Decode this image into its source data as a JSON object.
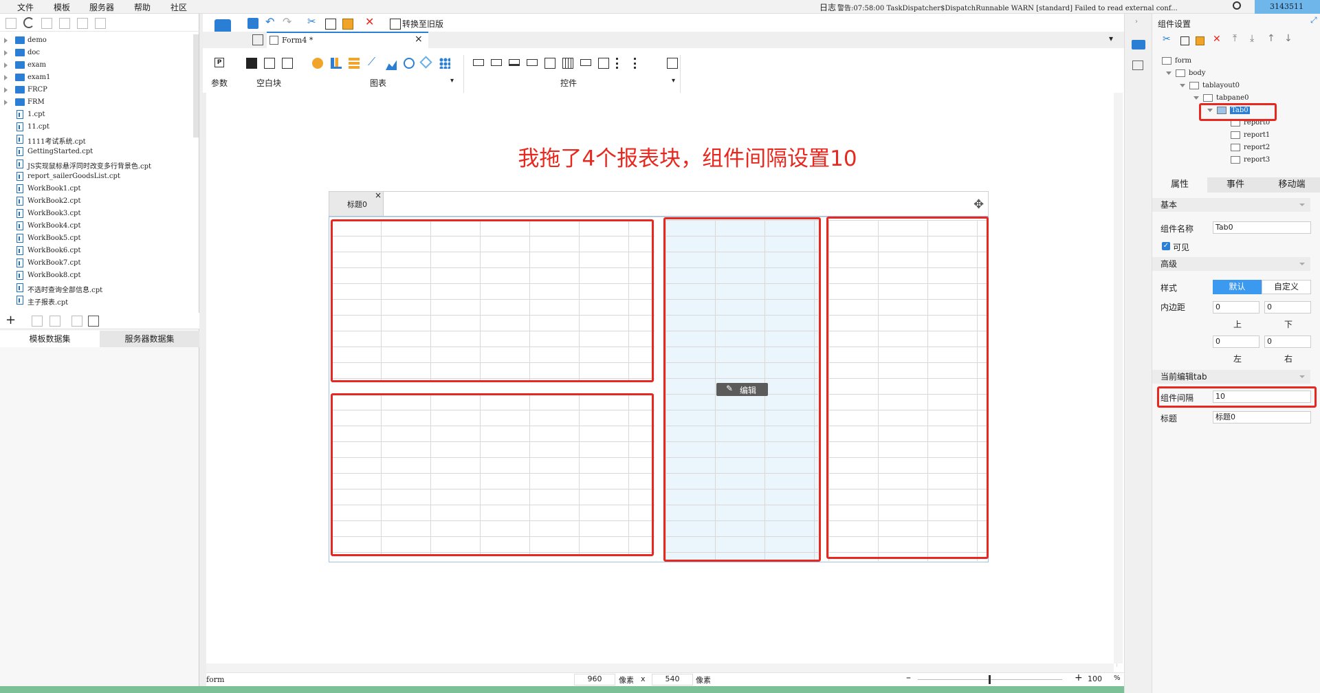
{
  "menu": [
    "文件",
    "模板",
    "服务器",
    "帮助",
    "社区"
  ],
  "status_bar": {
    "log_label": "日志",
    "warning": "警告:07:58:00 TaskDispatcher$DispatchRunnable WARN [standard] Failed to read external conf...",
    "user_id": "3143511"
  },
  "file_tree": [
    {
      "name": "demo",
      "type": "folder"
    },
    {
      "name": "doc",
      "type": "folder"
    },
    {
      "name": "exam",
      "type": "folder"
    },
    {
      "name": "exam1",
      "type": "folder"
    },
    {
      "name": "FRCP",
      "type": "folder"
    },
    {
      "name": "FRM",
      "type": "folder"
    },
    {
      "name": "1.cpt",
      "type": "file"
    },
    {
      "name": "11.cpt",
      "type": "file"
    },
    {
      "name": "1111考试系统.cpt",
      "type": "file"
    },
    {
      "name": "GettingStarted.cpt",
      "type": "file"
    },
    {
      "name": "JS实现鼠标悬浮同时改变多行背景色.cpt",
      "type": "file"
    },
    {
      "name": "report_sailerGoodsList.cpt",
      "type": "file"
    },
    {
      "name": "WorkBook1.cpt",
      "type": "file"
    },
    {
      "name": "WorkBook2.cpt",
      "type": "file"
    },
    {
      "name": "WorkBook3.cpt",
      "type": "file"
    },
    {
      "name": "WorkBook4.cpt",
      "type": "file"
    },
    {
      "name": "WorkBook5.cpt",
      "type": "file"
    },
    {
      "name": "WorkBook6.cpt",
      "type": "file"
    },
    {
      "name": "WorkBook7.cpt",
      "type": "file"
    },
    {
      "name": "WorkBook8.cpt",
      "type": "file"
    },
    {
      "name": "不选时查询全部信息.cpt",
      "type": "file"
    },
    {
      "name": "主子报表.cpt",
      "type": "file"
    }
  ],
  "dataset_tabs": [
    "模板数据集",
    "服务器数据集"
  ],
  "toolbar": {
    "convert_label": "转换至旧版",
    "doc_tab": "Form4 *",
    "groups": {
      "param": "参数",
      "blank": "空白块",
      "chart": "图表",
      "widget": "控件"
    }
  },
  "annotation": "我拖了4个报表块，组件间隔设置10",
  "canvas": {
    "tab_title": "标题0",
    "edit_label": "编辑"
  },
  "footer": {
    "left": "form",
    "width": "960",
    "width_unit": "像素",
    "times": "x",
    "height": "540",
    "height_unit": "像素",
    "zoom": "100",
    "zoom_unit": "%"
  },
  "right_panel": {
    "title": "组件设置",
    "tree": [
      {
        "name": "form",
        "depth": 0
      },
      {
        "name": "body",
        "depth": 1
      },
      {
        "name": "tablayout0",
        "depth": 2
      },
      {
        "name": "tabpane0",
        "depth": 3
      },
      {
        "name": "Tab0",
        "depth": 4,
        "selected": true
      },
      {
        "name": "report0",
        "depth": 5
      },
      {
        "name": "report1",
        "depth": 5
      },
      {
        "name": "report2",
        "depth": 5
      },
      {
        "name": "report3",
        "depth": 5
      }
    ],
    "tabs": [
      "属性",
      "事件",
      "移动端"
    ],
    "basic": "基本",
    "name_label": "组件名称",
    "name_value": "Tab0",
    "visible_label": "可见",
    "advanced": "高级",
    "style_label": "样式",
    "style_default": "默认",
    "style_custom": "自定义",
    "padding_label": "内边距",
    "pad_top": "0",
    "pad_bottom": "0",
    "pad_left": "0",
    "pad_right": "0",
    "pad_top_label": "上",
    "pad_bottom_label": "下",
    "pad_left_label": "左",
    "pad_right_label": "右",
    "current_tab": "当前编辑tab",
    "gap_label": "组件间隔",
    "gap_value": "10",
    "title_label": "标题",
    "title_value": "标题0"
  }
}
